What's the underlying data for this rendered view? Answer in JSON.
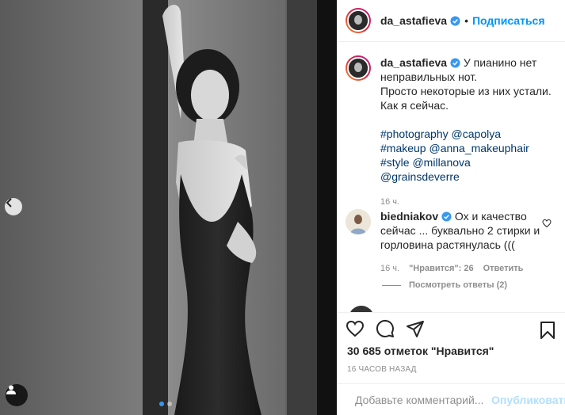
{
  "post": {
    "username": "da_astafieva",
    "follow_label": "Подписаться"
  },
  "caption": {
    "username": "da_astafieva",
    "line1": "У пианино нет",
    "line2": "неправильных нот.",
    "line3": "Просто некоторые из них устали.",
    "line4": "Как я сейчас.",
    "tag1": "#photography",
    "tag2": "@capolya",
    "tag3": "#makeup",
    "tag4": "@anna_makeuphair",
    "tag5": "#style",
    "tag6": "@millanova",
    "tag7": "@grainsdeverre",
    "time": "16 ч."
  },
  "comment": {
    "username": "biedniakov",
    "text1": "Ох и качество",
    "text2": "сейчас ... буквально 2 стирки и",
    "text3": "горловина растянулась (((",
    "time": "16 ч.",
    "likes": "\"Нравится\": 26",
    "reply_label": "Ответить",
    "view_replies": "Посмотреть ответы (2)"
  },
  "actions": {
    "likes_count": "30 685 отметок \"Нравится\"",
    "time_ago": "16 ЧАСОВ НАЗАД"
  },
  "add_comment": {
    "placeholder": "Добавьте комментарий...",
    "publish_label": "Опубликовать"
  },
  "colors": {
    "accent": "#0095f6",
    "link": "#00376b",
    "muted": "#8e8e8e",
    "verified": "#3897f0"
  },
  "carousel": {
    "total": 2,
    "active": 1
  }
}
